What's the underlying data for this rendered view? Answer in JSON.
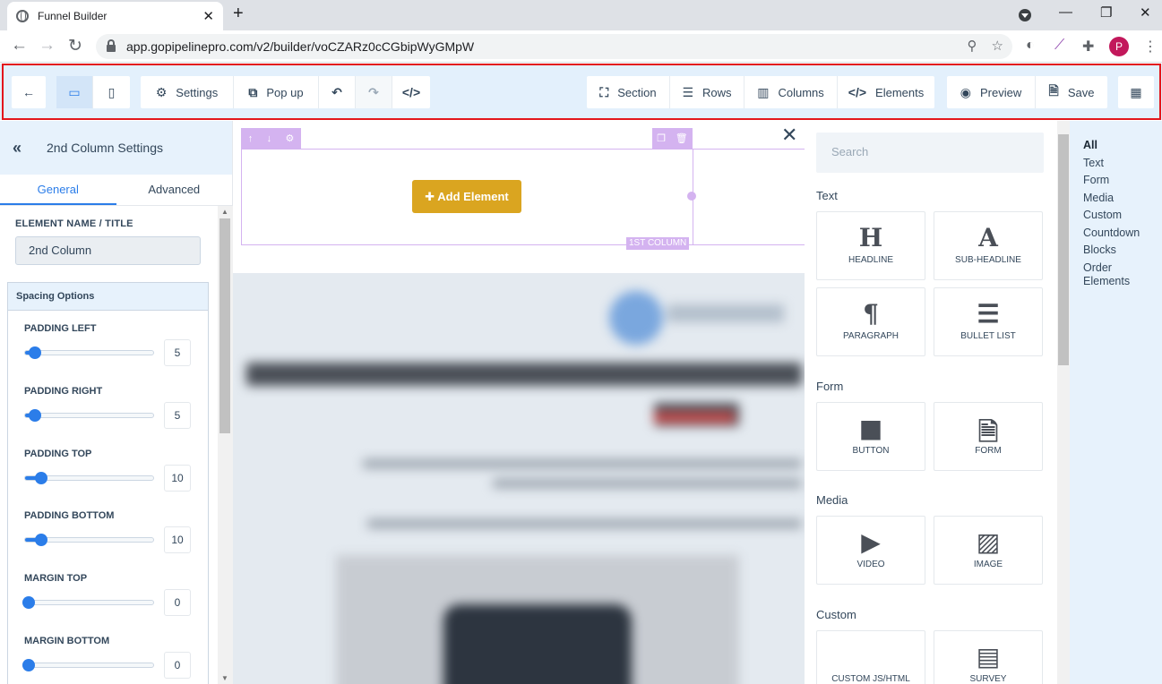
{
  "browser": {
    "tab_title": "Funnel Builder",
    "url": "app.gopipelinepro.com/v2/builder/voCZARz0cCGbipWyGMpW",
    "profile_initial": "P"
  },
  "toolbar": {
    "settings": "Settings",
    "popup": "Pop up",
    "section": "Section",
    "rows": "Rows",
    "columns": "Columns",
    "elements": "Elements",
    "preview": "Preview",
    "save": "Save"
  },
  "left_panel": {
    "title": "2nd Column Settings",
    "tabs": [
      "General",
      "Advanced"
    ],
    "name_label": "ELEMENT NAME / TITLE",
    "name_value": "2nd Column",
    "spacing_title": "Spacing Options",
    "spacing": [
      {
        "label": "PADDING LEFT",
        "value": "5",
        "level": 0.05
      },
      {
        "label": "PADDING RIGHT",
        "value": "5",
        "level": 0.05
      },
      {
        "label": "PADDING TOP",
        "value": "10",
        "level": 0.1
      },
      {
        "label": "PADDING BOTTOM",
        "value": "10",
        "level": 0.1
      },
      {
        "label": "MARGIN TOP",
        "value": "0",
        "level": 0
      },
      {
        "label": "MARGIN BOTTOM",
        "value": "0",
        "level": 0
      }
    ]
  },
  "canvas": {
    "add_element": "Add Element",
    "column_label": "1ST COLUMN"
  },
  "elements_panel": {
    "search_placeholder": "Search",
    "categories": [
      {
        "name": "Text",
        "items": [
          {
            "label": "HEADLINE",
            "icon": "headline-icon"
          },
          {
            "label": "SUB-HEADLINE",
            "icon": "sub-headline-icon"
          },
          {
            "label": "PARAGRAPH",
            "icon": "paragraph-icon"
          },
          {
            "label": "BULLET LIST",
            "icon": "bullet-list-icon"
          }
        ]
      },
      {
        "name": "Form",
        "items": [
          {
            "label": "BUTTON",
            "icon": "button-icon"
          },
          {
            "label": "FORM",
            "icon": "form-icon"
          }
        ]
      },
      {
        "name": "Media",
        "items": [
          {
            "label": "VIDEO",
            "icon": "video-icon"
          },
          {
            "label": "IMAGE",
            "icon": "image-icon"
          }
        ]
      },
      {
        "name": "Custom",
        "items": [
          {
            "label": "CUSTOM JS/HTML",
            "icon": "code-icon"
          },
          {
            "label": "SURVEY",
            "icon": "survey-icon"
          }
        ]
      }
    ]
  },
  "category_nav": [
    "All",
    "Text",
    "Form",
    "Media",
    "Custom",
    "Countdown",
    "Blocks",
    "Order Elements"
  ],
  "colors": {
    "accent": "#2b7de9",
    "add_button": "#daa520",
    "highlight_border": "#e3161c",
    "column_outline": "#d4b3f0"
  }
}
